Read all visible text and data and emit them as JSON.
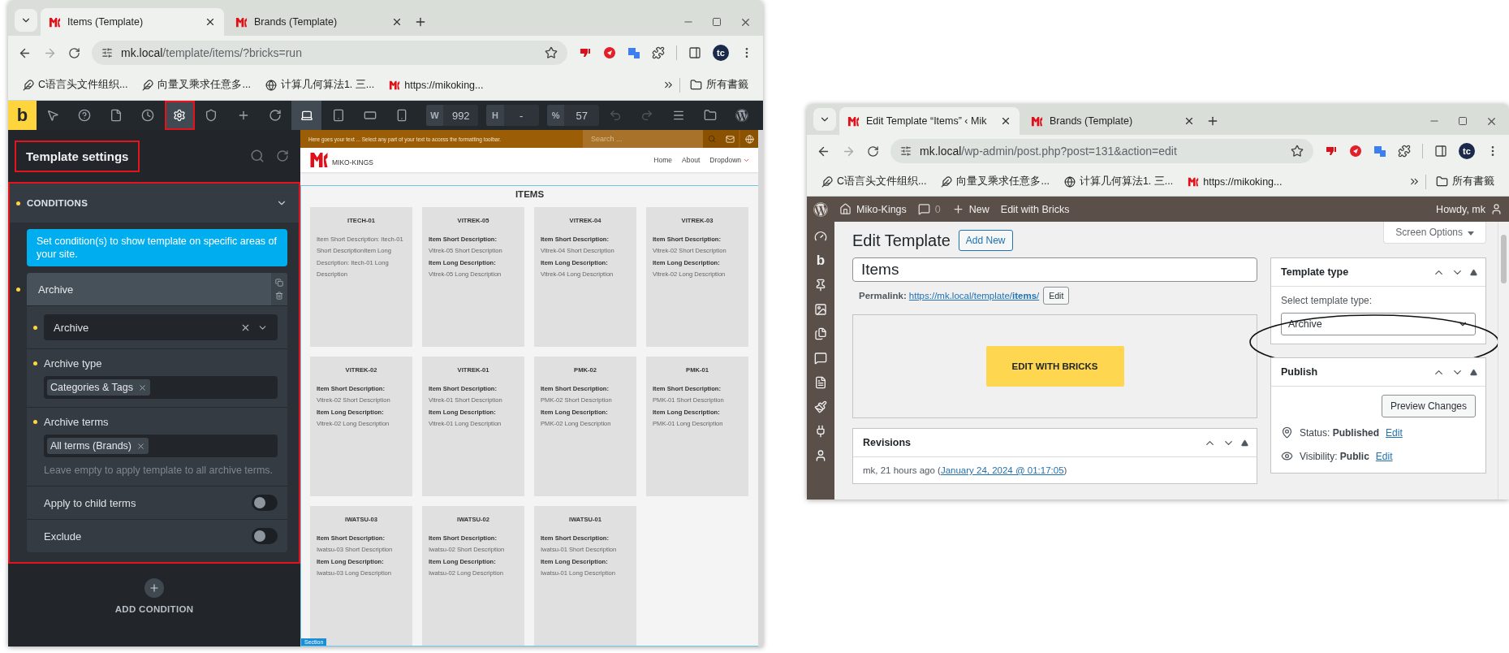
{
  "left_window": {
    "tabs": [
      {
        "title": "Items (Template)",
        "selected": true
      },
      {
        "title": "Brands (Template)",
        "selected": false
      }
    ],
    "url_host": "mk.local",
    "url_path": "/template/items/?bricks=run",
    "profile": "tc",
    "bookmarks": [
      {
        "kind": "feather",
        "label": "C语言头文件组织..."
      },
      {
        "kind": "feather",
        "label": "向量叉乘求任意多..."
      },
      {
        "kind": "globe",
        "label": "计算几何算法1. 三..."
      },
      {
        "kind": "logo",
        "label": "https://mikoking..."
      }
    ],
    "bookmarks_folder": "所有書籤",
    "builder": {
      "logo": "b",
      "tools": [
        {
          "kind": "pointer",
          "selected": false,
          "outlined": false
        },
        {
          "kind": "help",
          "selected": false,
          "outlined": false
        },
        {
          "kind": "page",
          "selected": false,
          "outlined": false
        },
        {
          "kind": "history",
          "selected": false,
          "outlined": false
        },
        {
          "kind": "settings",
          "selected": true,
          "outlined": true
        },
        {
          "kind": "html5",
          "selected": false,
          "outlined": false
        },
        {
          "kind": "add",
          "selected": false,
          "outlined": false
        },
        {
          "kind": "refresh",
          "selected": false,
          "outlined": false
        }
      ],
      "devices": [
        {
          "kind": "laptop",
          "selected": true
        },
        {
          "kind": "tablet",
          "selected": false
        },
        {
          "kind": "tablet-landscape",
          "selected": false
        },
        {
          "kind": "phone",
          "selected": false
        }
      ],
      "fields": [
        {
          "label": "W",
          "value": "992"
        },
        {
          "label": "H",
          "value": "-"
        },
        {
          "label": "%",
          "value": "57"
        }
      ],
      "actions": [
        {
          "kind": "undo",
          "disabled": true
        },
        {
          "kind": "redo",
          "disabled": true
        },
        {
          "kind": "menu",
          "disabled": false
        },
        {
          "kind": "folder",
          "disabled": false
        },
        {
          "kind": "wordpress",
          "disabled": false
        }
      ]
    },
    "sidebar": {
      "title": "Template settings",
      "title_outlined": true,
      "section": {
        "title": "CONDITIONS",
        "expanded": true,
        "outlined": true,
        "modified": true
      },
      "info": "Set condition(s) to show template on specific areas of your site.",
      "condition": {
        "title": "Archive",
        "modified": true,
        "fields": [
          {
            "kind": "select",
            "value": "Archive",
            "modified": true
          },
          {
            "kind": "tags",
            "label": "Archive type",
            "tags": [
              "Categories & Tags"
            ],
            "modified": true
          },
          {
            "kind": "tags",
            "label": "Archive terms",
            "tags": [
              "All terms (Brands)"
            ],
            "hint": "Leave empty to apply template to all archive terms.",
            "modified": true
          },
          {
            "kind": "toggle",
            "label": "Apply to child terms",
            "on": false,
            "modified": false
          },
          {
            "kind": "toggle",
            "label": "Exclude",
            "on": false,
            "modified": false
          }
        ]
      },
      "add_button": "ADD CONDITION"
    },
    "canvas": {
      "topbar_text": "Here goes your text ... Select any part of your text to access the formatting toolbar.",
      "search_placeholder": "Search ...",
      "site_name": "MIKO-KINGS",
      "nav": [
        {
          "kind": "link",
          "label": "Home"
        },
        {
          "kind": "link",
          "label": "About"
        },
        {
          "kind": "dropdown",
          "label": "Dropdown"
        }
      ],
      "heading": "ITEMS",
      "section_label": "Section",
      "cards": [
        {
          "title": "ITECH-01",
          "lines": [
            {
              "text": "Item Short Description: Itech-01 Short DescriptionItem Long Description: Itech-01 Long Description",
              "bold": false
            }
          ]
        },
        {
          "title": "VITREK-05",
          "lines": [
            {
              "text": "Item Short Description:",
              "bold": true
            },
            {
              "text": "Vitrek-05 Short Description",
              "bold": false
            },
            {
              "text": "Item Long Description:",
              "bold": true
            },
            {
              "text": "Vitrek-05 Long Description",
              "bold": false
            }
          ]
        },
        {
          "title": "VITREK-04",
          "lines": [
            {
              "text": "Item Short Description:",
              "bold": true
            },
            {
              "text": "Vitrek-04 Short Description",
              "bold": false
            },
            {
              "text": "Item Long Description:",
              "bold": true
            },
            {
              "text": "Vitrek-04 Long Description",
              "bold": false
            }
          ]
        },
        {
          "title": "VITREK-03",
          "lines": [
            {
              "text": "Item Short Description:",
              "bold": true
            },
            {
              "text": "Vitrek-02 Short Description",
              "bold": false
            },
            {
              "text": "Item Long Description:",
              "bold": true
            },
            {
              "text": "Vitrek-02 Long Description",
              "bold": false
            }
          ]
        },
        {
          "title": "VITREK-02",
          "lines": [
            {
              "text": "Item Short Description:",
              "bold": true
            },
            {
              "text": "Vitrek-02 Short Description",
              "bold": false
            },
            {
              "text": "Item Long Description:",
              "bold": true
            },
            {
              "text": "Vitrek-02 Long Description",
              "bold": false
            }
          ]
        },
        {
          "title": "VITREK-01",
          "lines": [
            {
              "text": "Item Short Description:",
              "bold": true
            },
            {
              "text": "Vitrek-01 Short Description",
              "bold": false
            },
            {
              "text": "Item Long Description:",
              "bold": true
            },
            {
              "text": "Vitrek-01 Long Description",
              "bold": false
            }
          ]
        },
        {
          "title": "PMK-02",
          "lines": [
            {
              "text": "Item Short Description:",
              "bold": true
            },
            {
              "text": "PMK-02 Short Description",
              "bold": false
            },
            {
              "text": "Item Long Description:",
              "bold": true
            },
            {
              "text": "PMK-02 Long Description",
              "bold": false
            }
          ]
        },
        {
          "title": "PMK-01",
          "lines": [
            {
              "text": "Item Short Description:",
              "bold": true
            },
            {
              "text": "PMK-01 Short Description",
              "bold": false
            },
            {
              "text": "Item Long Description:",
              "bold": true
            },
            {
              "text": "PMK-01 Long Description",
              "bold": false
            }
          ]
        },
        {
          "title": "IWATSU-03",
          "lines": [
            {
              "text": "Item Short Description:",
              "bold": true
            },
            {
              "text": "Iwatsu-03 Short Description",
              "bold": false
            },
            {
              "text": "Item Long Description:",
              "bold": true
            },
            {
              "text": "Iwatsu-03 Long Description",
              "bold": false
            }
          ]
        },
        {
          "title": "IWATSU-02",
          "lines": [
            {
              "text": "Item Short Description:",
              "bold": true
            },
            {
              "text": "Iwatsu-02 Short Description",
              "bold": false
            },
            {
              "text": "Item Long Description:",
              "bold": true
            },
            {
              "text": "Iwatsu-02 Long Description",
              "bold": false
            }
          ]
        },
        {
          "title": "IWATSU-01",
          "lines": [
            {
              "text": "Item Short Description:",
              "bold": true
            },
            {
              "text": "Iwatsu-01 Short Description",
              "bold": false
            },
            {
              "text": "Item Long Description:",
              "bold": true
            },
            {
              "text": "Iwatsu-01 Long Description",
              "bold": false
            }
          ]
        }
      ]
    }
  },
  "right_window": {
    "tabs": [
      {
        "title": "Edit Template “Items” ‹ Mik",
        "selected": true
      },
      {
        "title": "Brands (Template)",
        "selected": false
      }
    ],
    "url_host": "mk.local",
    "url_path": "/wp-admin/post.php?post=131&action=edit",
    "profile": "tc",
    "bookmarks": [
      {
        "kind": "feather",
        "label": "C语言头文件组织..."
      },
      {
        "kind": "feather",
        "label": "向量叉乘求任意多..."
      },
      {
        "kind": "globe",
        "label": "计算几何算法1. 三..."
      },
      {
        "kind": "logo",
        "label": "https://mikoking..."
      }
    ],
    "bookmarks_folder": "所有書籤",
    "admin_bar": {
      "site": "Miko-Kings",
      "comments": "0",
      "new": "New",
      "edit": "Edit with Bricks",
      "greeting": "Howdy, mk"
    },
    "menu": [
      {
        "kind": "dashboard"
      },
      {
        "kind": "bricks",
        "label": "b"
      },
      {
        "kind": "pin"
      },
      {
        "kind": "media"
      },
      {
        "kind": "pages"
      },
      {
        "kind": "comments"
      },
      {
        "kind": "forms"
      },
      {
        "kind": "appearance"
      },
      {
        "kind": "plugins"
      },
      {
        "kind": "users"
      }
    ],
    "screen_options": "Screen Options",
    "heading": "Edit Template",
    "add_new": "Add New",
    "title_value": "Items",
    "permalink": {
      "label": "Permalink:",
      "url": "https://mk.local/template/**items**/",
      "button": "Edit"
    },
    "bricks_button": "EDIT WITH BRICKS",
    "revisions": {
      "title": "Revisions",
      "prefix": "mk, 21 hours ago (",
      "link": "January 24, 2024 @ 01:17:05",
      "suffix": ")"
    },
    "template_type": {
      "title": "Template type",
      "label": "Select template type:",
      "value": "Archive",
      "circled": true
    },
    "publish": {
      "title": "Publish",
      "preview": "Preview Changes",
      "rows": [
        {
          "kind": "status",
          "text": "Status: **Published**",
          "link": "Edit"
        },
        {
          "kind": "visibility",
          "text": "Visibility: **Public**",
          "link": "Edit"
        }
      ]
    }
  }
}
